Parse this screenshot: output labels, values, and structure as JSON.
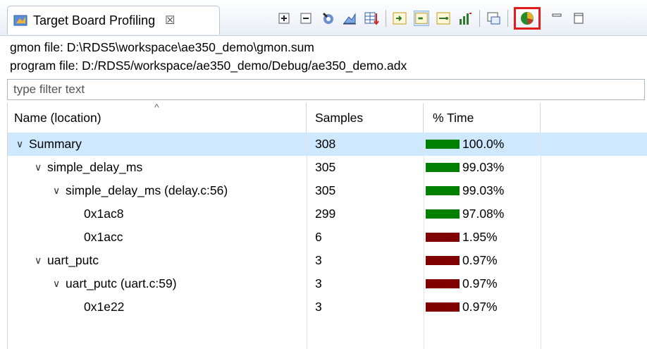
{
  "view": {
    "title": "Target Board Profiling",
    "close_glyph": "☒",
    "icon": "profiling-view-icon"
  },
  "toolbar": {
    "icons": [
      "expand-all-icon",
      "collapse-all-icon",
      "hotspot-icon",
      "chart-icon",
      "export-icon",
      "sort-icon",
      "bar-view-icon",
      "bar-view-2-icon",
      "bar-view-3-icon",
      "graph-icon",
      "refresh-icon",
      "pie-chart-icon"
    ],
    "minimize": "minimize-icon",
    "maximize": "maximize-icon"
  },
  "info": {
    "gmon": "gmon file: D:\\RDS5\\workspace\\ae350_demo\\gmon.sum",
    "program": "program file: D:/RDS5/workspace/ae350_demo/Debug/ae350_demo.adx"
  },
  "filter": {
    "placeholder": "type filter text"
  },
  "table": {
    "headers": {
      "name": "Name (location)",
      "samples": "Samples",
      "time": "% Time"
    },
    "rows": [
      {
        "indent": 0,
        "expanded": true,
        "name": "Summary",
        "samples": "308",
        "time": "100.0%",
        "fraction": 1.0,
        "color": "#008000"
      },
      {
        "indent": 1,
        "expanded": true,
        "name": "simple_delay_ms",
        "samples": "305",
        "time": "99.03%",
        "fraction": 0.9903,
        "color": "#008000"
      },
      {
        "indent": 2,
        "expanded": true,
        "name": "simple_delay_ms (delay.c:56)",
        "samples": "305",
        "time": "99.03%",
        "fraction": 0.9903,
        "color": "#008000"
      },
      {
        "indent": 3,
        "expanded": false,
        "name": "0x1ac8",
        "samples": "299",
        "time": "97.08%",
        "fraction": 0.9708,
        "color": "#008000"
      },
      {
        "indent": 3,
        "expanded": false,
        "name": "0x1acc",
        "samples": "6",
        "time": "1.95%",
        "fraction": 0.0195,
        "color": "#800000"
      },
      {
        "indent": 1,
        "expanded": true,
        "name": "uart_putc",
        "samples": "3",
        "time": "0.97%",
        "fraction": 0.0097,
        "color": "#800000"
      },
      {
        "indent": 2,
        "expanded": true,
        "name": "uart_putc (uart.c:59)",
        "samples": "3",
        "time": "0.97%",
        "fraction": 0.0097,
        "color": "#800000"
      },
      {
        "indent": 3,
        "expanded": false,
        "name": "0x1e22",
        "samples": "3",
        "time": "0.97%",
        "fraction": 0.0097,
        "color": "#800000"
      }
    ]
  }
}
